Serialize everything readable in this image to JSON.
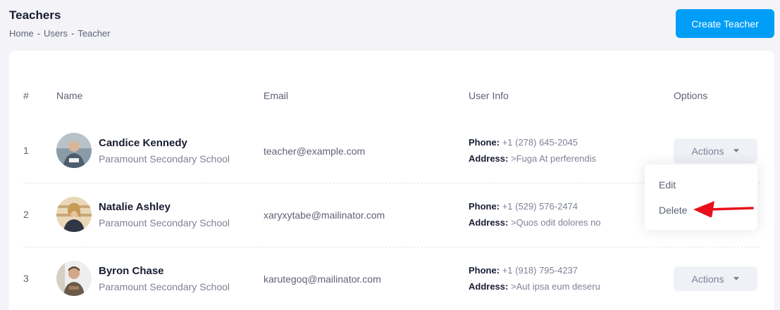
{
  "header": {
    "title": "Teachers",
    "breadcrumb": [
      "Home",
      "Users",
      "Teacher"
    ],
    "breadcrumb_sep": "-",
    "create_button": "Create Teacher"
  },
  "table": {
    "columns": [
      "#",
      "Name",
      "Email",
      "User Info",
      "Options"
    ],
    "phone_label": "Phone:",
    "address_label": "Address:",
    "actions_label": "Actions",
    "rows": [
      {
        "num": "1",
        "name": "Candice Kennedy",
        "school": "Paramount Secondary School",
        "email": "teacher@example.com",
        "phone": "+1 (278) 645-2045",
        "address": ">Fuga At perferendis"
      },
      {
        "num": "2",
        "name": "Natalie Ashley",
        "school": "Paramount Secondary School",
        "email": "xaryxytabe@mailinator.com",
        "phone": "+1 (529) 576-2474",
        "address": ">Quos odit dolores no"
      },
      {
        "num": "3",
        "name": "Byron Chase",
        "school": "Paramount Secondary School",
        "email": "karutegoq@mailinator.com",
        "phone": "+1 (918) 795-4237",
        "address": ">Aut ipsa eum deseru"
      }
    ]
  },
  "dropdown": {
    "items": [
      "Edit",
      "Delete"
    ]
  },
  "colors": {
    "primary": "#009ef7",
    "annotation_arrow": "#e8101a"
  }
}
